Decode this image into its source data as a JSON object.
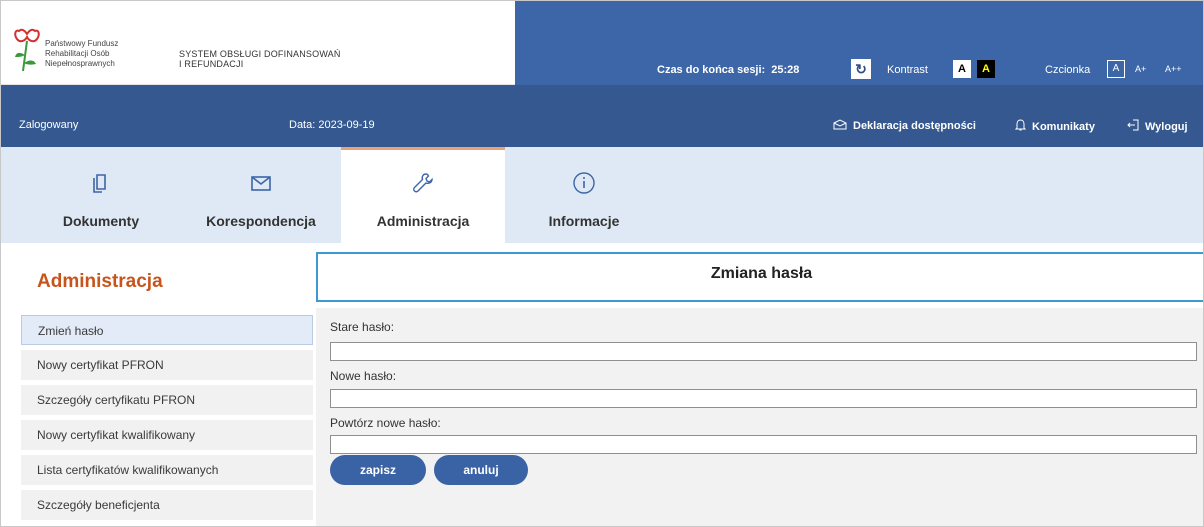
{
  "header": {
    "org_lines": [
      "Państwowy Fundusz",
      "Rehabilitacji Osób",
      "Niepełnosprawnych"
    ],
    "system_lines": [
      "SYSTEM OBSŁUGI DOFINANSOWAŃ",
      "I REFUNDACJI"
    ],
    "session_label": "Czas do końca sesji:",
    "session_time": "25:28",
    "refresh_icon": "↻",
    "contrast_label": "Kontrast",
    "contrast_options": [
      "A",
      "A"
    ],
    "font_label": "Czcionka",
    "font_options": [
      "A",
      "A+",
      "A++"
    ],
    "colors": {
      "brand_blue": "#3c66a7",
      "bar_blue": "#34588f",
      "accent_orange": "#c7541c",
      "active_border": "#3b9ad6"
    }
  },
  "infobar": {
    "logged_in": "Zalogowany",
    "date": "Data: 2023-09-19",
    "links": [
      {
        "label": "Deklaracja dostępności",
        "icon": "envelope-open-icon"
      },
      {
        "label": "Komunikaty",
        "icon": "bell-icon"
      },
      {
        "label": "Wyloguj",
        "icon": "logout-icon"
      }
    ]
  },
  "tabs": [
    {
      "label": "Dokumenty",
      "icon": "documents-icon"
    },
    {
      "label": "Korespondencja",
      "icon": "envelope-icon"
    },
    {
      "label": "Administracja",
      "icon": "wrench-icon",
      "active": true
    },
    {
      "label": "Informacje",
      "icon": "info-icon"
    }
  ],
  "sidebar": {
    "title": "Administracja",
    "items": [
      {
        "label": "Zmień hasło",
        "active": true
      },
      {
        "label": "Nowy certyfikat PFRON"
      },
      {
        "label": "Szczegóły certyfikatu PFRON"
      },
      {
        "label": "Nowy certyfikat kwalifikowany"
      },
      {
        "label": "Lista certyfikatów kwalifikowanych"
      },
      {
        "label": "Szczegóły beneficjenta"
      }
    ]
  },
  "main": {
    "title": "Zmiana hasła",
    "fields": [
      {
        "label": "Stare hasło:",
        "value": ""
      },
      {
        "label": "Nowe hasło:",
        "value": ""
      },
      {
        "label": "Powtórz nowe hasło:",
        "value": ""
      }
    ],
    "save_label": "zapisz",
    "cancel_label": "anuluj"
  }
}
